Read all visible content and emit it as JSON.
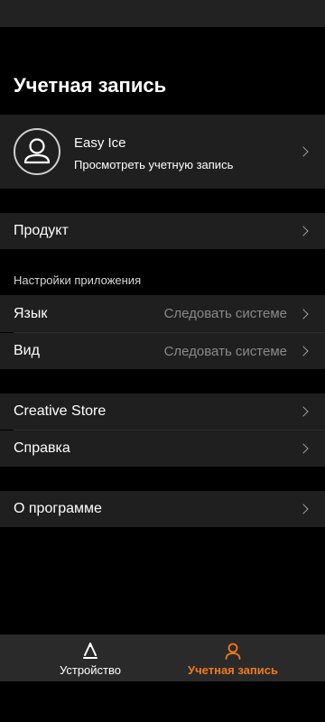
{
  "page_title": "Учетная запись",
  "profile": {
    "name": "Easy Ice",
    "subtitle": "Просмотреть учетную запись",
    "avatar_icon": "user-avatar-icon"
  },
  "product_row": {
    "label": "Продукт"
  },
  "app_settings": {
    "header": "Настройки приложения",
    "items": [
      {
        "label": "Язык",
        "value": "Следовать системе"
      },
      {
        "label": "Вид",
        "value": "Следовать системе"
      }
    ]
  },
  "support": {
    "items": [
      {
        "label": "Creative Store"
      },
      {
        "label": "Справка"
      }
    ]
  },
  "about_row": {
    "label": "О программе"
  },
  "bottom_nav": {
    "items": [
      {
        "label": "Устройство",
        "icon": "device-icon",
        "active": false
      },
      {
        "label": "Учетная запись",
        "icon": "account-icon",
        "active": true
      }
    ]
  },
  "colors": {
    "background": "#000000",
    "row_background": "#1f1f1f",
    "accent": "#f07a1c",
    "secondary_text": "#8a8a8a"
  }
}
